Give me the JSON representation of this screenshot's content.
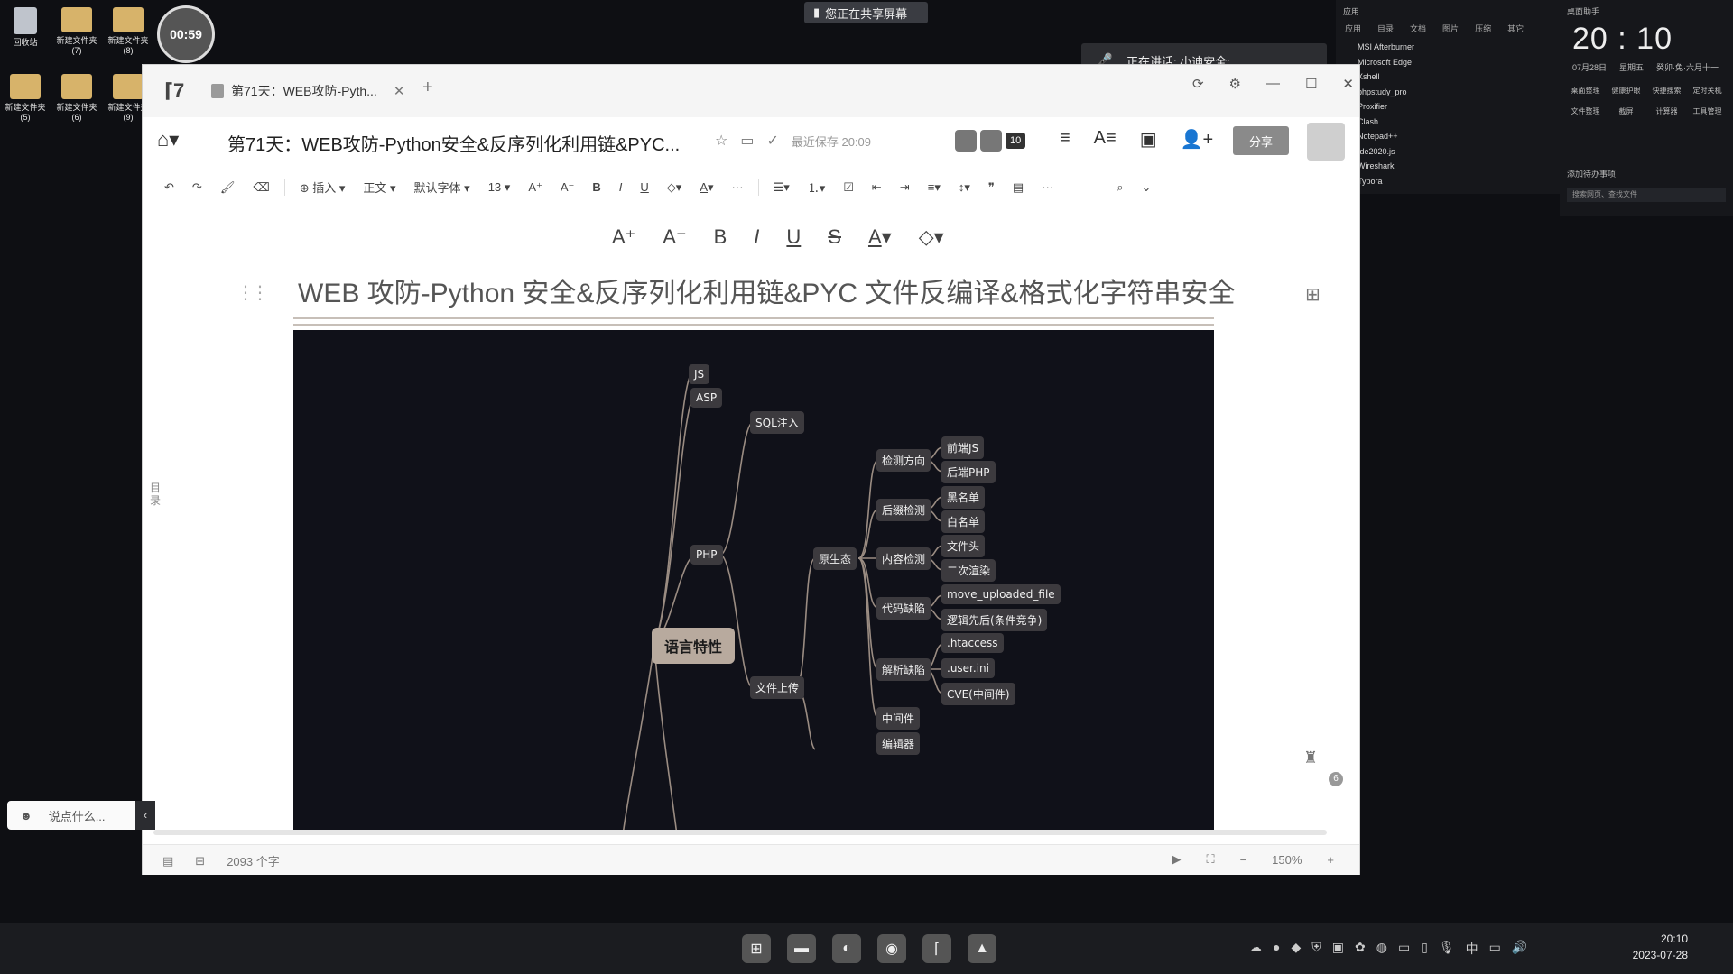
{
  "desktop": {
    "icons": [
      {
        "label": "回收站"
      },
      {
        "label": "新建文件夹 (7)"
      },
      {
        "label": "新建文件夹 (8)"
      },
      {
        "label": "新建文件夹 (5)"
      },
      {
        "label": "新建文件夹 (6)"
      },
      {
        "label": "新建文件夹 (9)"
      }
    ],
    "timer": "00:59"
  },
  "banner": {
    "sharing": "您正在共享屏幕"
  },
  "speaking": {
    "label": "正在讲话: 小迪安全;"
  },
  "launcher": {
    "header": "应用",
    "tabs": [
      "应用",
      "目录",
      "文档",
      "图片",
      "压缩",
      "其它"
    ],
    "apps": [
      "MSI Afterburner",
      "Microsoft Edge",
      "Xshell",
      "phpstudy_pro",
      "Proxifier",
      "Clash",
      "Notepad++",
      "Ide2020.js",
      "Wireshark",
      "Typora"
    ]
  },
  "clock_widget": {
    "label": "桌面助手",
    "time": "20 : 10",
    "date": "07月28日",
    "weekday": "星期五",
    "lunar": "癸卯·兔·六月十一",
    "tools": [
      "桌面整理",
      "健康护眼",
      "快捷搜索",
      "定时关机",
      "文件整理",
      "截屏",
      "计算器",
      "工具管理"
    ],
    "add_task": "添加待办事项",
    "search_placeholder": "搜索网页、查找文件"
  },
  "window": {
    "tab_title": "第71天：WEB攻防-Pyth...",
    "doc_title": "第71天：WEB攻防-Python安全&反序列化利用链&PYC...",
    "saved": "最近保存 20:09",
    "collab_count": "10",
    "share": "分享",
    "toolbar": {
      "insert": "插入",
      "style": "正文",
      "font": "默认字体",
      "size": "13"
    },
    "heading": "WEB 攻防-Python 安全&反序列化利用链&PYC 文件反编译&格式化字符串安全",
    "toc": "目录",
    "status": {
      "word_count": "2093 个字",
      "zoom": "150%"
    },
    "badge": "6"
  },
  "mindmap": {
    "root": "语言特性",
    "nodes": {
      "js": "JS",
      "asp": "ASP",
      "php": "PHP",
      "sql": "SQL注入",
      "upload": "文件上传",
      "native": "原生态",
      "detect_dir": "检测方向",
      "front_js": "前端JS",
      "back_php": "后端PHP",
      "suffix": "后缀检测",
      "blacklist": "黑名单",
      "whitelist": "白名单",
      "content": "内容检测",
      "filehead": "文件头",
      "render": "二次渲染",
      "codeflaw": "代码缺陷",
      "move": "move_uploaded_file",
      "logic": "逻辑先后(条件竞争)",
      "parse": "解析缺陷",
      "htaccess": ".htaccess",
      "userini": ".user.ini",
      "cve": "CVE(中间件)",
      "middleware": "中间件",
      "editor": "编辑器"
    }
  },
  "chat": {
    "placeholder": "说点什么..."
  },
  "taskbar": {
    "time": "20:10",
    "date": "2023-07-28",
    "ime": "中"
  }
}
